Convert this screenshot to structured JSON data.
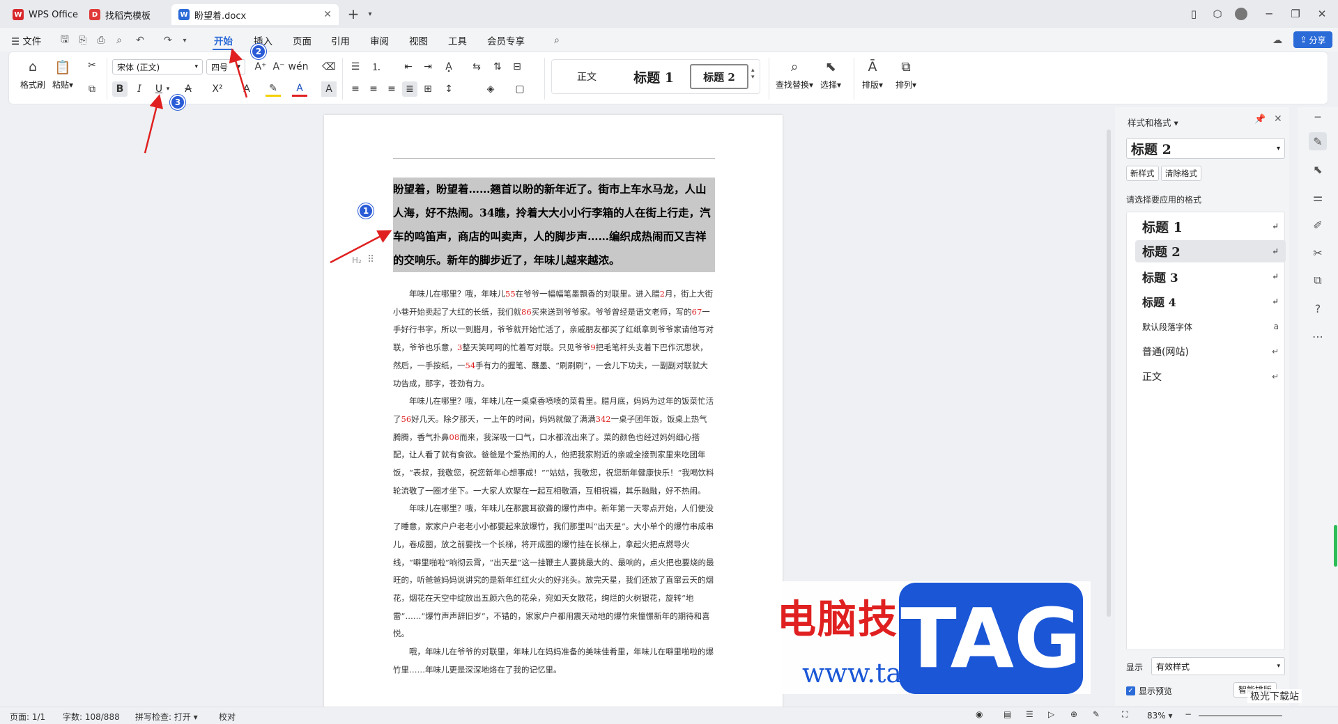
{
  "tabs": [
    {
      "label": "WPS Office"
    },
    {
      "label": "找稻壳模板"
    },
    {
      "label": "盼望着.docx"
    }
  ],
  "menu": {
    "file": "文件",
    "items": [
      "开始",
      "插入",
      "页面",
      "引用",
      "审阅",
      "视图",
      "工具",
      "会员专享"
    ],
    "share": "分享"
  },
  "ribbon": {
    "format_painter": "格式刷",
    "paste": "粘贴",
    "font_name": "宋体 (正文)",
    "font_size": "四号",
    "styles": [
      "正文",
      "标题 1",
      "标题 2"
    ],
    "find_replace": "查找替换",
    "select": "选择",
    "layout": "排版",
    "arrange": "排列"
  },
  "document": {
    "heading": "盼望着，盼望着……翘首以盼的新年近了。街市上车水马龙，人山人海，好不热闹。34瞧，拎着大大小小行李箱的人在街上行走，汽车的鸣笛声，商店的叫卖声，人的脚步声……编织成热闹而又吉祥的交响乐。新年的脚步近了，年味儿越来越浓。",
    "heading_tag": "H₂",
    "p1": [
      "年味儿在哪里？哦，年味儿",
      "55",
      "在爷爷一幅幅笔墨飘香的对联里。进入腊",
      "2",
      "月，街上大街小巷开始卖起了大红的长纸，我们就",
      "86",
      "买来送到爷爷家。爷爷曾经是语文老师，写的",
      "67",
      "一手好行书字，所以一到腊月，爷爷就开始忙活了，亲戚朋友都买了红纸拿到爷爷家请他写对联，爷爷也乐意，",
      "3",
      "整天笑呵呵的忙着写对联。只见爷爷",
      "9",
      "把毛笔杆头支着下巴作沉思状，然后，一手按纸，一",
      "54",
      "手有力的握笔、蘸墨、“刷刷刷”，一会儿下功夫，一副副对联就大功告成，那字，苍劲有力。"
    ],
    "p2": [
      "年味儿在哪里？哦，年味儿在一桌桌香喷喷的菜肴里。腊月底，妈妈为过年的饭菜忙活了",
      "56",
      "好几天。除夕那天，一上午的时间，妈妈就做了满满",
      "342",
      "一桌子团年饭，饭桌上热气腾腾，香气扑鼻",
      "08",
      "而来，我深吸一口气，口水都流出来了。菜的颜色也经过妈妈细心搭配，让人看了就有食欲。爸爸是个爱热闹的人，他把我家附近的亲戚全接到家里来吃团年饭，“表叔，我敬您，祝您新年心想事成！”“姑姑，我敬您，祝您新年健康快乐！”我喝饮料轮流敬了一圈才坐下。一大家人欢聚在一起互相敬酒，互相祝福，其乐融融，好不热闹。"
    ],
    "p3": "年味儿在哪里？哦，年味儿在那震耳欲聋的爆竹声中。新年第一天零点开始，人们便没了睡意，家家户户老老小小都要起来放爆竹，我们那里叫“出天星”。大小单个的爆竹串成串儿，卷成圈，放之前要找一个长梯，将开成圈的爆竹挂在长梯上，拿起火把点燃导火线，“噼里啪啦”响彻云霄，“出天星”这一挂鞭主人要挑最大的、最响的，点火把也要烧的最旺的，听爸爸妈妈说讲究的是新年红红火火的好兆头。放完天星，我们还放了直窜云天的烟花，烟花在天空中绽放出五颜六色的花朵，宛如天女散花，绚烂的火树银花，旋转“地雷”……“爆竹声声辞旧岁”，不错的，家家户户都用震天动地的爆竹来憧憬新年的期待和喜悦。",
    "p4": "哦，年味儿在爷爷的对联里，年味儿在妈妈准备的美味佳肴里，年味儿在噼里啪啦的爆竹里……年味儿更是深深地烙在了我的记忆里。"
  },
  "panel": {
    "title": "样式和格式",
    "current_style": "标题 2",
    "new_style": "新样式",
    "clear_format": "清除格式",
    "choose_label": "请选择要应用的格式",
    "styles": [
      "标题 1",
      "标题 2",
      "标题 3",
      "标题 4",
      "默认段落字体",
      "普通(网站)",
      "正文"
    ],
    "show_label": "显示",
    "show_value": "有效样式",
    "preview_label": "显示预览",
    "smart_layout": "智能排版"
  },
  "status": {
    "page": "页面: 1/1",
    "words": "字数: 108/888",
    "spell": "拼写检查: 打开",
    "proof": "校对",
    "zoom": "83%"
  },
  "callouts": [
    "1",
    "2",
    "3"
  ],
  "watermark": {
    "cn": "电脑技术网",
    "url": "www.tagxp.com",
    "tag": "TAG",
    "site": "极光下载站"
  }
}
